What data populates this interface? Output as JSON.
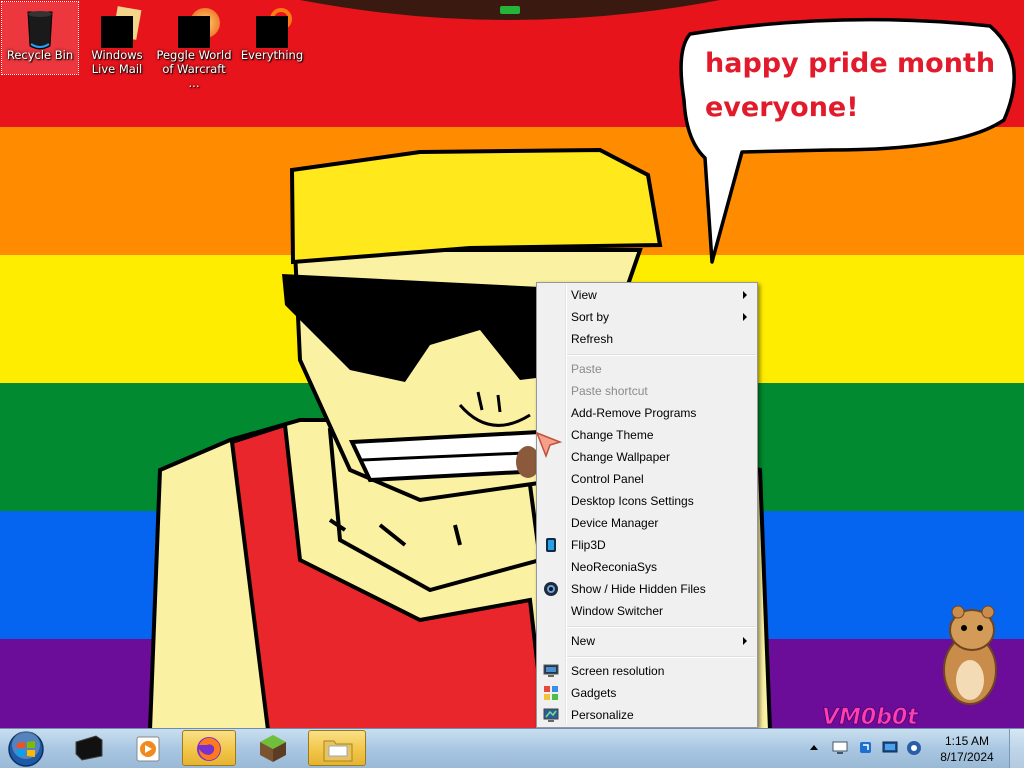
{
  "desktop_icons": [
    {
      "label": "Recycle Bin",
      "icon": "recycle-bin-icon"
    },
    {
      "label": "Windows Live Mail",
      "icon": "mail-icon"
    },
    {
      "label": "Peggle World of Warcraft ...",
      "icon": "peggle-icon"
    },
    {
      "label": "Everything",
      "icon": "everything-search-icon"
    }
  ],
  "wallpaper": {
    "speech_line1": "happy pride month",
    "speech_line2": "everyone!",
    "watermark": "VM0b0t",
    "stripe_colors": [
      "#e8141c",
      "#ff8c00",
      "#ffed00",
      "#018a2f",
      "#0564f0",
      "#6b0d99"
    ]
  },
  "context_menu": {
    "items": [
      {
        "label": "View",
        "submenu": true
      },
      {
        "label": "Sort by",
        "submenu": true
      },
      {
        "label": "Refresh"
      },
      {
        "label": "Paste",
        "disabled": true
      },
      {
        "label": "Paste shortcut",
        "disabled": true
      },
      {
        "label": "Add-Remove Programs"
      },
      {
        "label": "Change Theme"
      },
      {
        "label": "Change Wallpaper"
      },
      {
        "label": "Control Panel"
      },
      {
        "label": "Desktop Icons Settings"
      },
      {
        "label": "Device Manager"
      },
      {
        "label": "Flip3D",
        "icon": "flip3d-icon"
      },
      {
        "label": "NeoReconiaSys"
      },
      {
        "label": "Show / Hide Hidden Files",
        "icon": "hidden-files-icon"
      },
      {
        "label": "Window Switcher"
      },
      {
        "label": "New",
        "submenu": true
      },
      {
        "label": "Screen resolution",
        "icon": "monitor-icon"
      },
      {
        "label": "Gadgets",
        "icon": "gadgets-icon"
      },
      {
        "label": "Personalize",
        "icon": "personalize-icon"
      }
    ]
  },
  "taskbar": {
    "start_icon": "windows-logo-icon",
    "apps": [
      {
        "icon": "black-app-icon"
      },
      {
        "icon": "media-player-icon"
      },
      {
        "icon": "firefox-icon"
      },
      {
        "icon": "minecraft-icon"
      },
      {
        "icon": "explorer-folder-icon"
      }
    ],
    "clock_time": "1:15 AM",
    "clock_date": "8/17/2024"
  }
}
